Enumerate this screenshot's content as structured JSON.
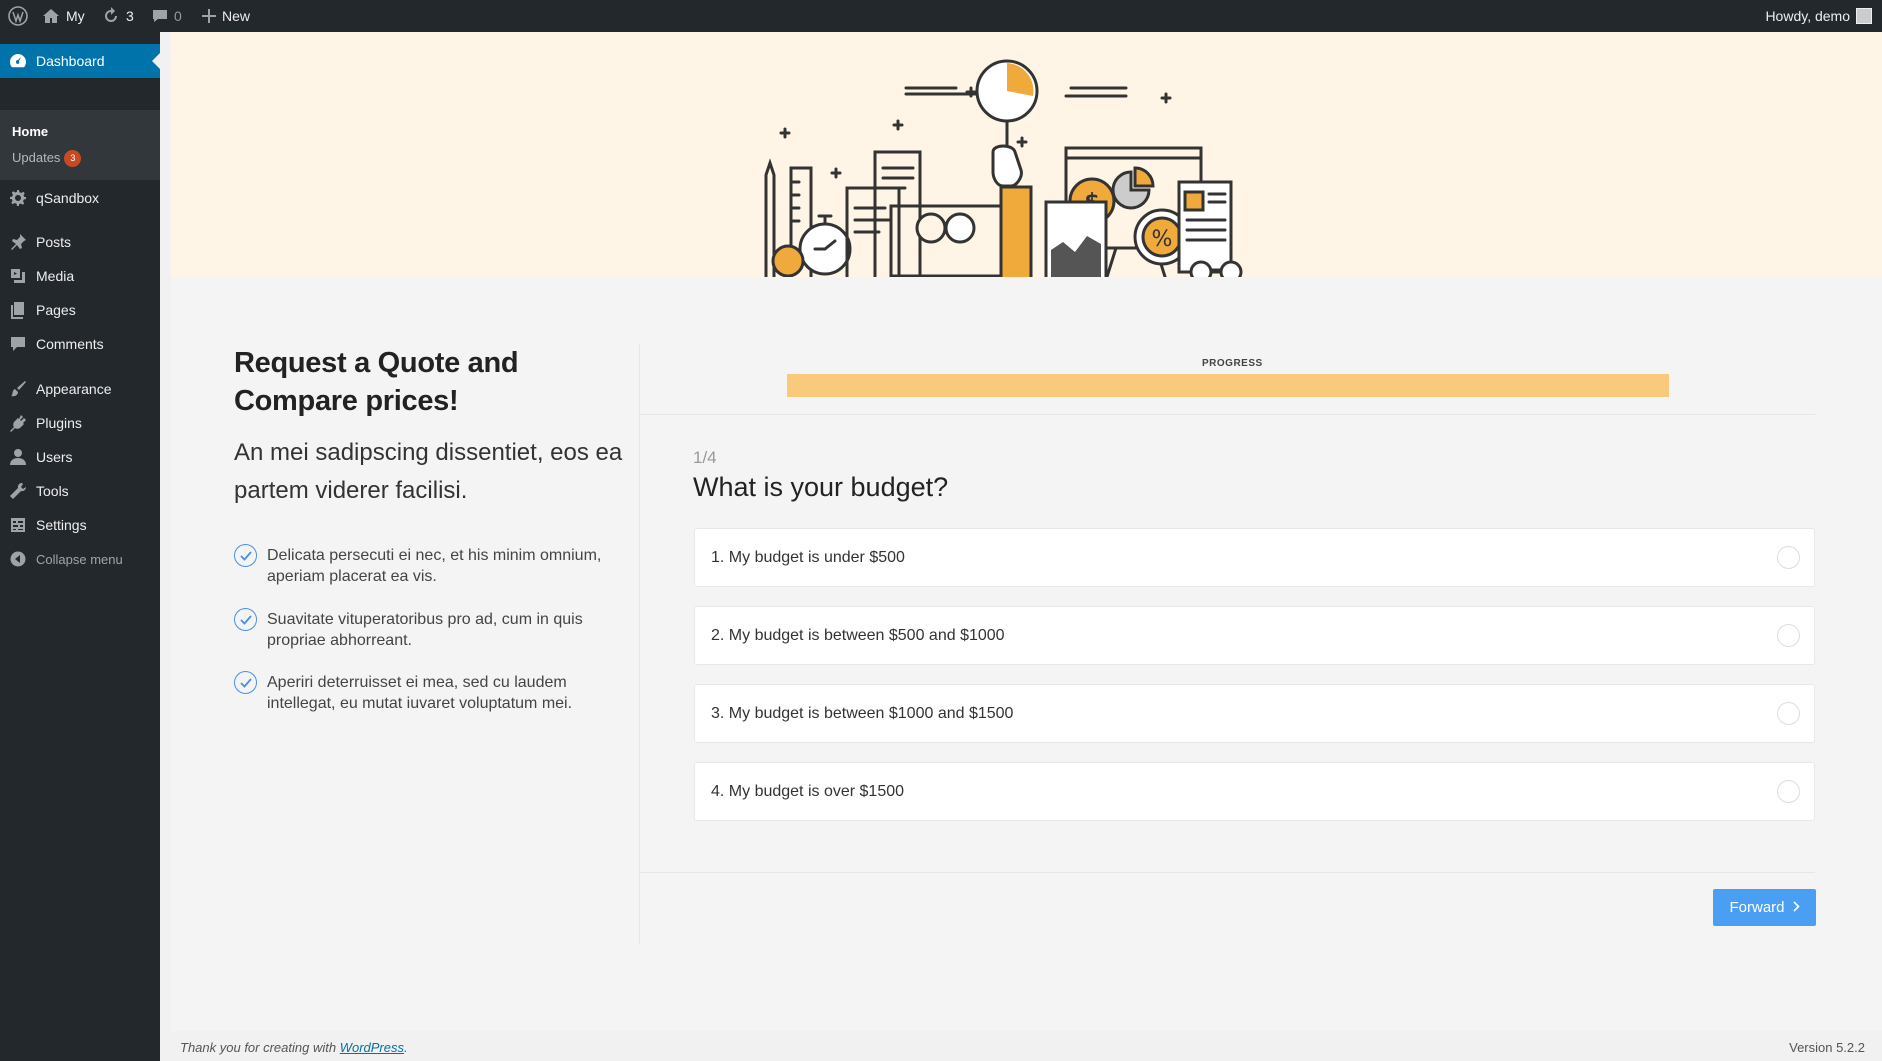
{
  "admin_bar": {
    "site_name": "My",
    "updates_count": "3",
    "comments_count": "0",
    "new_label": "New",
    "greeting": "Howdy, demo"
  },
  "sidebar": {
    "dashboard": "Dashboard",
    "home": "Home",
    "updates": "Updates",
    "updates_badge": "3",
    "items": [
      "qSandbox",
      "Posts",
      "Media",
      "Pages",
      "Comments",
      "Appearance",
      "Plugins",
      "Users",
      "Tools",
      "Settings"
    ],
    "collapse": "Collapse menu"
  },
  "intro": {
    "title": "Request a Quote and Compare prices!",
    "lead": "An mei sadipscing dissentiet, eos ea partem viderer facilisi.",
    "features": [
      "Delicata persecuti ei nec, et his minim omnium, aperiam placerat ea vis.",
      "Suavitate vituperatoribus pro ad, cum in quis propriae abhorreant.",
      "Aperiri deterruisset ei mea, sed cu laudem intellegat, eu mutat iuvaret voluptatum mei."
    ]
  },
  "form": {
    "progress_label": "PROGRESS",
    "progress_fraction": 1.0,
    "step": "1/4",
    "question": "What is your budget?",
    "options": [
      "1. My budget is under $500",
      "2. My budget is between $500 and $1000",
      "3. My budget is between $1000 and $1500",
      "4. My budget is over $1500"
    ],
    "forward_label": "Forward"
  },
  "footer": {
    "thanks_prefix": "Thank you for creating with ",
    "thanks_link": "WordPress",
    "thanks_suffix": ".",
    "version": "Version 5.2.2"
  },
  "colors": {
    "accent": "#0073aa",
    "progress": "#f9c97c",
    "button": "#4b9ff2",
    "hero_bg": "#fff5e6",
    "illustration_orange": "#f0a93b"
  }
}
